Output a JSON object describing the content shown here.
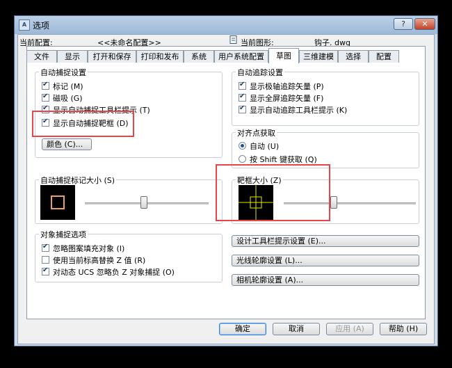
{
  "window": {
    "title": "选项",
    "app_icon": "A",
    "help_button": "?",
    "close_button": "✕"
  },
  "profile": {
    "current_profile_label": "当前配置:",
    "current_profile_value": "<<未命名配置>>",
    "current_drawing_label": "当前图形:",
    "current_drawing_value": "钩子. dwg"
  },
  "tabs": [
    {
      "label": "文件"
    },
    {
      "label": "显示"
    },
    {
      "label": "打开和保存"
    },
    {
      "label": "打印和发布"
    },
    {
      "label": "系统"
    },
    {
      "label": "用户系统配置"
    },
    {
      "label": "草图"
    },
    {
      "label": "三维建模"
    },
    {
      "label": "选择"
    },
    {
      "label": "配置"
    }
  ],
  "active_tab": "草图",
  "autosnap": {
    "title": "自动捕捉设置",
    "options": [
      {
        "label": "标记 (M)",
        "checked": true
      },
      {
        "label": "磁吸 (G)",
        "checked": true
      },
      {
        "label": "显示自动捕捉工具栏提示 (T)",
        "checked": true
      },
      {
        "label": "显示自动捕捉靶框 (D)",
        "checked": true
      }
    ],
    "color_button": "颜色 (C)..."
  },
  "autotrack": {
    "title": "自动追踪设置",
    "options": [
      {
        "label": "显示极轴追踪矢量 (P)",
        "checked": true
      },
      {
        "label": "显示全屏追踪矢量 (F)",
        "checked": true
      },
      {
        "label": "显示自动追踪工具栏提示 (K)",
        "checked": true
      }
    ]
  },
  "alignment": {
    "title": "对齐点获取",
    "options": [
      {
        "label": "自动 (U)",
        "selected": true
      },
      {
        "label": "按 Shift 键获取 (Q)",
        "selected": false
      }
    ]
  },
  "marker_size": {
    "title": "自动捕捉标记大小 (S)",
    "level": 0.48
  },
  "aperture_size": {
    "title": "靶框大小 (Z)",
    "level": 0.38
  },
  "object_snap": {
    "title": "对象捕捉选项",
    "options": [
      {
        "label": "忽略图案填充对象 (I)",
        "checked": true
      },
      {
        "label": "使用当前标高替换 Z 值 (R)",
        "checked": false
      },
      {
        "label": "对动态 UCS 忽略负 Z 对象捕捉 (O)",
        "checked": true
      }
    ]
  },
  "side_buttons": {
    "tooltip_settings": "设计工具栏提示设置 (E)...",
    "lightglyph_settings": "光线轮廓设置 (L)...",
    "camera_settings": "相机轮廓设置 (A)..."
  },
  "footer": {
    "ok": "确定",
    "cancel": "取消",
    "apply": "应用 (A)",
    "help": "帮助 (H)"
  },
  "colors": {
    "highlight_box": "#e8454a",
    "marker_color": "#e8a06a",
    "aperture_color": "#e6e600"
  }
}
